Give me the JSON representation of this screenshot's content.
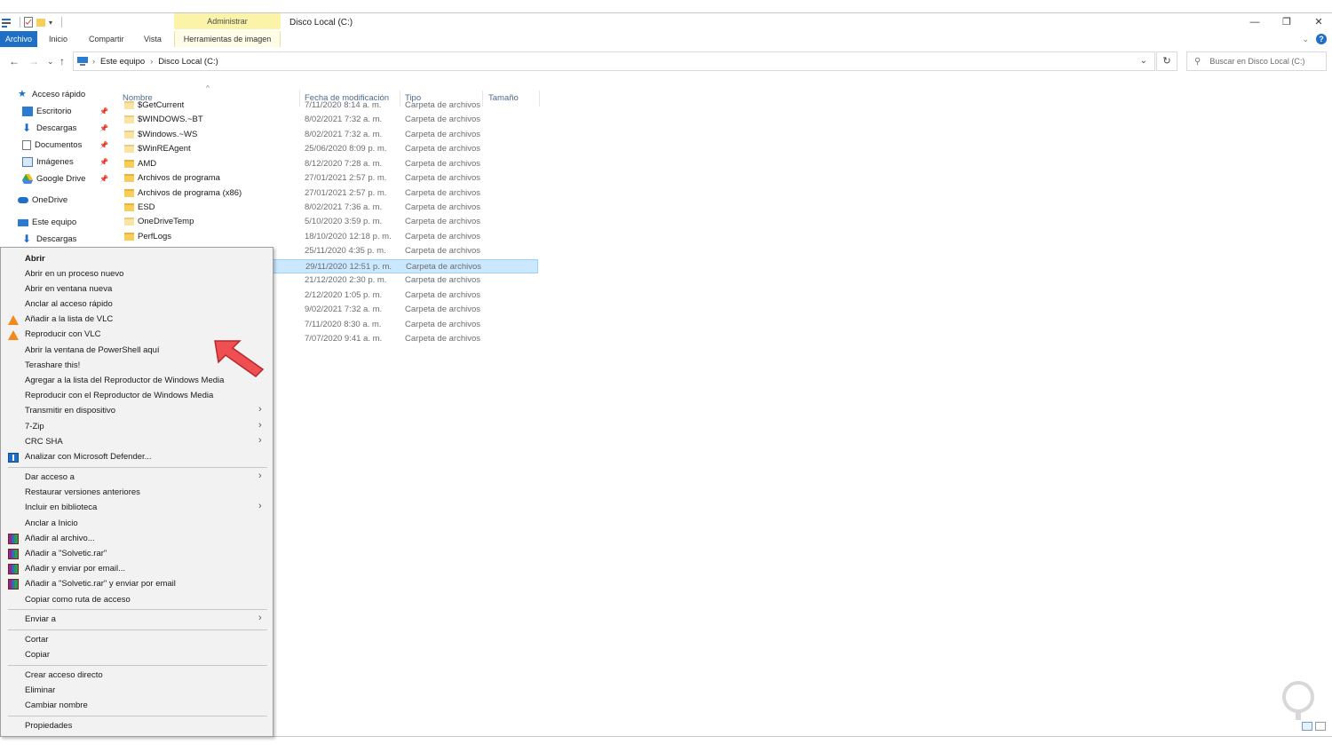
{
  "window": {
    "title": "Disco Local (C:)",
    "context_tab_group": "Administrar",
    "controls": [
      "—",
      "❐",
      "✕"
    ]
  },
  "ribbon": {
    "tabs": [
      "Archivo",
      "Inicio",
      "Compartir",
      "Vista"
    ],
    "context_tab": "Herramientas de imagen"
  },
  "address": {
    "segments": [
      "Este equipo",
      "Disco Local (C:)"
    ],
    "search_placeholder": "Buscar en Disco Local (C:)"
  },
  "nav": {
    "quick_access": "Acceso rápido",
    "items": [
      "Escritorio",
      "Descargas",
      "Documentos",
      "Imágenes",
      "Google Drive"
    ],
    "onedrive": "OneDrive",
    "this_pc": "Este equipo",
    "this_pc_child": "Descargas"
  },
  "columns": {
    "name": "Nombre",
    "date": "Fecha de modificación",
    "type": "Tipo",
    "size": "Tamaño"
  },
  "files": [
    {
      "name": "$GetCurrent",
      "date": "7/11/2020 8:14 a. m.",
      "type": "Carpeta de archivos"
    },
    {
      "name": "$WINDOWS.~BT",
      "date": "8/02/2021 7:32 a. m.",
      "type": "Carpeta de archivos"
    },
    {
      "name": "$Windows.~WS",
      "date": "8/02/2021 7:32 a. m.",
      "type": "Carpeta de archivos"
    },
    {
      "name": "$WinREAgent",
      "date": "25/06/2020 8:09 p. m.",
      "type": "Carpeta de archivos"
    },
    {
      "name": "AMD",
      "date": "8/12/2020 7:28 a. m.",
      "type": "Carpeta de archivos"
    },
    {
      "name": "Archivos de programa",
      "date": "27/01/2021 2:57 p. m.",
      "type": "Carpeta de archivos"
    },
    {
      "name": "Archivos de programa (x86)",
      "date": "27/01/2021 2:57 p. m.",
      "type": "Carpeta de archivos"
    },
    {
      "name": "ESD",
      "date": "8/02/2021 7:36 a. m.",
      "type": "Carpeta de archivos"
    },
    {
      "name": "OneDriveTemp",
      "date": "5/10/2020 3:59 p. m.",
      "type": "Carpeta de archivos"
    },
    {
      "name": "PerfLogs",
      "date": "18/10/2020 12:18 p. m.",
      "type": "Carpeta de archivos"
    },
    {
      "name": "",
      "date": "25/11/2020 4:35 p. m.",
      "type": "Carpeta de archivos"
    },
    {
      "name": "",
      "date": "29/11/2020 12:51 p. m.",
      "type": "Carpeta de archivos"
    },
    {
      "name": "",
      "date": "21/12/2020 2:30 p. m.",
      "type": "Carpeta de archivos"
    },
    {
      "name": "",
      "date": "2/12/2020 1:05 p. m.",
      "type": "Carpeta de archivos"
    },
    {
      "name": "",
      "date": "9/02/2021 7:32 a. m.",
      "type": "Carpeta de archivos"
    },
    {
      "name": "",
      "date": "7/11/2020 8:30 a. m.",
      "type": "Carpeta de archivos"
    },
    {
      "name": "",
      "date": "7/07/2020 9:41 a. m.",
      "type": "Carpeta de archivos"
    }
  ],
  "menu": {
    "open": "Abrir",
    "open_new_process": "Abrir en un proceso nuevo",
    "open_new_window": "Abrir en ventana nueva",
    "pin_quick": "Anclar al acceso rápido",
    "vlc_add": "Añadir a la lista de VLC",
    "vlc_play": "Reproducir con VLC",
    "powershell": "Abrir la ventana de PowerShell aquí",
    "terashare": "Terashare this!",
    "wmp_add": "Agregar a la lista del Reproductor de Windows Media",
    "wmp_play": "Reproducir con el Reproductor de Windows Media",
    "cast": "Transmitir en dispositivo",
    "zip": "7-Zip",
    "crc": "CRC SHA",
    "defender": "Analizar con Microsoft Defender...",
    "give_access": "Dar acceso a",
    "restore": "Restaurar versiones anteriores",
    "include_lib": "Incluir en biblioteca",
    "pin_start": "Anclar a Inicio",
    "rar_add": "Añadir al archivo...",
    "rar_add_named": "Añadir a \"Solvetic.rar\"",
    "rar_email": "Añadir y enviar por email...",
    "rar_named_email": "Añadir a \"Solvetic.rar\" y enviar por email",
    "copy_path": "Copiar como ruta de acceso",
    "send_to": "Enviar a",
    "cut": "Cortar",
    "copy": "Copiar",
    "shortcut": "Crear acceso directo",
    "delete": "Eliminar",
    "rename": "Cambiar nombre",
    "properties": "Propiedades"
  }
}
